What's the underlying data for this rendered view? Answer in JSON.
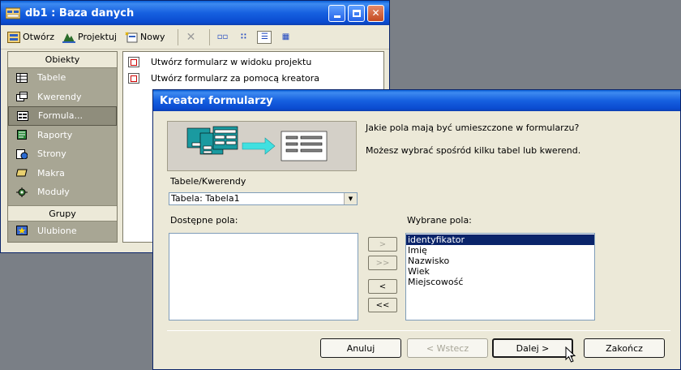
{
  "db_window": {
    "title": "db1 : Baza danych",
    "toolbar": {
      "open_label": "Otwórz",
      "design_label": "Projektuj",
      "new_label": "Nowy"
    },
    "objects_header": "Obiekty",
    "objects": [
      {
        "label": "Tabele",
        "icon": "table-icon"
      },
      {
        "label": "Kwerendy",
        "icon": "query-icon"
      },
      {
        "label": "Formula...",
        "icon": "form-icon",
        "selected": true
      },
      {
        "label": "Raporty",
        "icon": "report-icon"
      },
      {
        "label": "Strony",
        "icon": "page-icon"
      },
      {
        "label": "Makra",
        "icon": "macro-icon"
      },
      {
        "label": "Moduły",
        "icon": "module-icon"
      }
    ],
    "groups_header": "Grupy",
    "groups": [
      {
        "label": "Ulubione",
        "icon": "favorites-icon"
      }
    ],
    "list_items": [
      "Utwórz formularz w widoku projektu",
      "Utwórz formularz za pomocą kreatora"
    ]
  },
  "wizard": {
    "title": "Kreator formularzy",
    "question1": "Jakie pola mają być umieszczone w formularzu?",
    "question2": "Możesz wybrać spośród kilku tabel lub kwerend.",
    "tables_label": "Tabele/Kwerendy",
    "table_select_value": "Tabela: Tabela1",
    "available_label": "Dostępne pola:",
    "available_fields": [],
    "selected_label": "Wybrane pola:",
    "selected_fields": [
      "identyfikator",
      "Imię",
      "Nazwisko",
      "Wiek",
      "Miejscowość"
    ],
    "move_buttons": {
      "add_one": ">",
      "add_all": ">>",
      "remove_one": "<",
      "remove_all": "<<"
    },
    "buttons": {
      "cancel": "Anuluj",
      "back": "< Wstecz",
      "next": "Dalej >",
      "finish": "Zakończ"
    }
  },
  "colors": {
    "titlebar": "#0a5fd8",
    "panel": "#a8a694",
    "selection": "#0a246a"
  }
}
